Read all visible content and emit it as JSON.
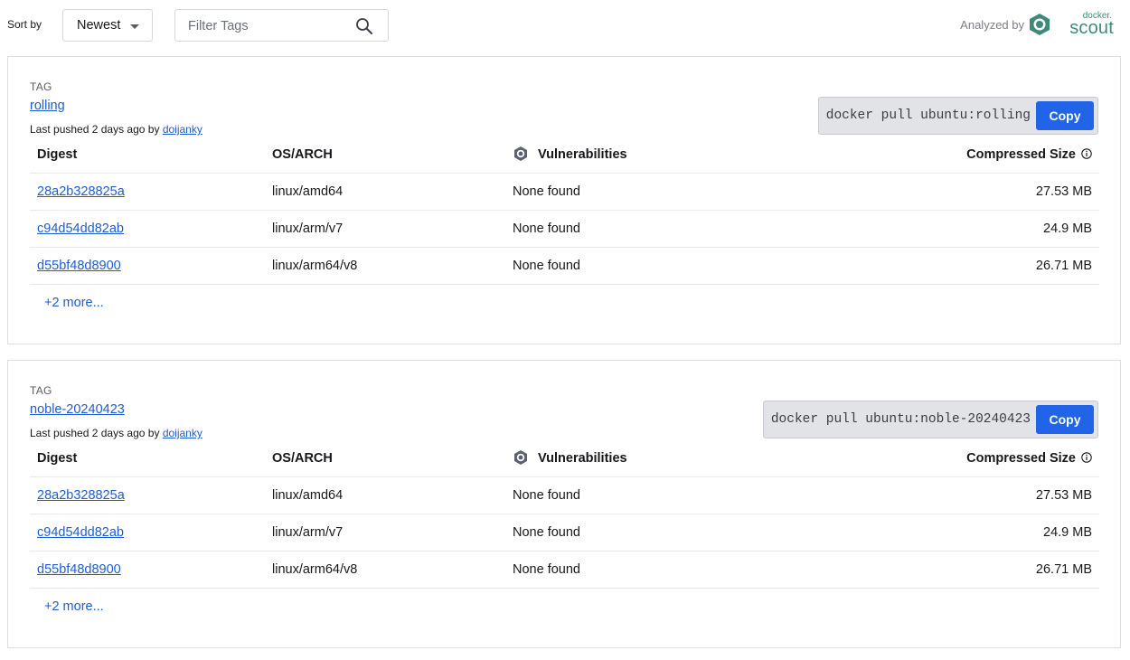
{
  "toolbar": {
    "sort_label": "Sort by",
    "sort_value": "Newest",
    "filter_placeholder": "Filter Tags",
    "analyzed_by": "Analyzed by",
    "logo_small": "docker.",
    "logo_big": "scout"
  },
  "table_headers": {
    "digest": "Digest",
    "os_arch": "OS/ARCH",
    "vulnerabilities": "Vulnerabilities",
    "compressed_size": "Compressed Size"
  },
  "tags": [
    {
      "label": "TAG",
      "name": "rolling",
      "pushed_prefix": "Last pushed",
      "pushed_when": "2 days ago",
      "pushed_by": "by",
      "pushed_user": "doijanky",
      "pull_command": "docker pull ubuntu:rolling",
      "copy_label": "Copy",
      "rows": [
        {
          "digest": "28a2b328825a",
          "os_arch": "linux/amd64",
          "vulnerabilities": "None found",
          "size": "27.53 MB"
        },
        {
          "digest": "c94d54dd82ab",
          "os_arch": "linux/arm/v7",
          "vulnerabilities": "None found",
          "size": "24.9 MB"
        },
        {
          "digest": "d55bf48d8900",
          "os_arch": "linux/arm64/v8",
          "vulnerabilities": "None found",
          "size": "26.71 MB"
        }
      ],
      "more": "+2 more..."
    },
    {
      "label": "TAG",
      "name": "noble-20240423",
      "pushed_prefix": "Last pushed",
      "pushed_when": "2 days ago",
      "pushed_by": "by",
      "pushed_user": "doijanky",
      "pull_command": "docker pull ubuntu:noble-20240423",
      "copy_label": "Copy",
      "rows": [
        {
          "digest": "28a2b328825a",
          "os_arch": "linux/amd64",
          "vulnerabilities": "None found",
          "size": "27.53 MB"
        },
        {
          "digest": "c94d54dd82ab",
          "os_arch": "linux/arm/v7",
          "vulnerabilities": "None found",
          "size": "24.9 MB"
        },
        {
          "digest": "d55bf48d8900",
          "os_arch": "linux/arm64/v8",
          "vulnerabilities": "None found",
          "size": "26.71 MB"
        }
      ],
      "more": "+2 more..."
    }
  ],
  "colors": {
    "link": "#1f5ccf",
    "copy_button": "#2164e8",
    "scout_brand": "#3d8a7a"
  }
}
